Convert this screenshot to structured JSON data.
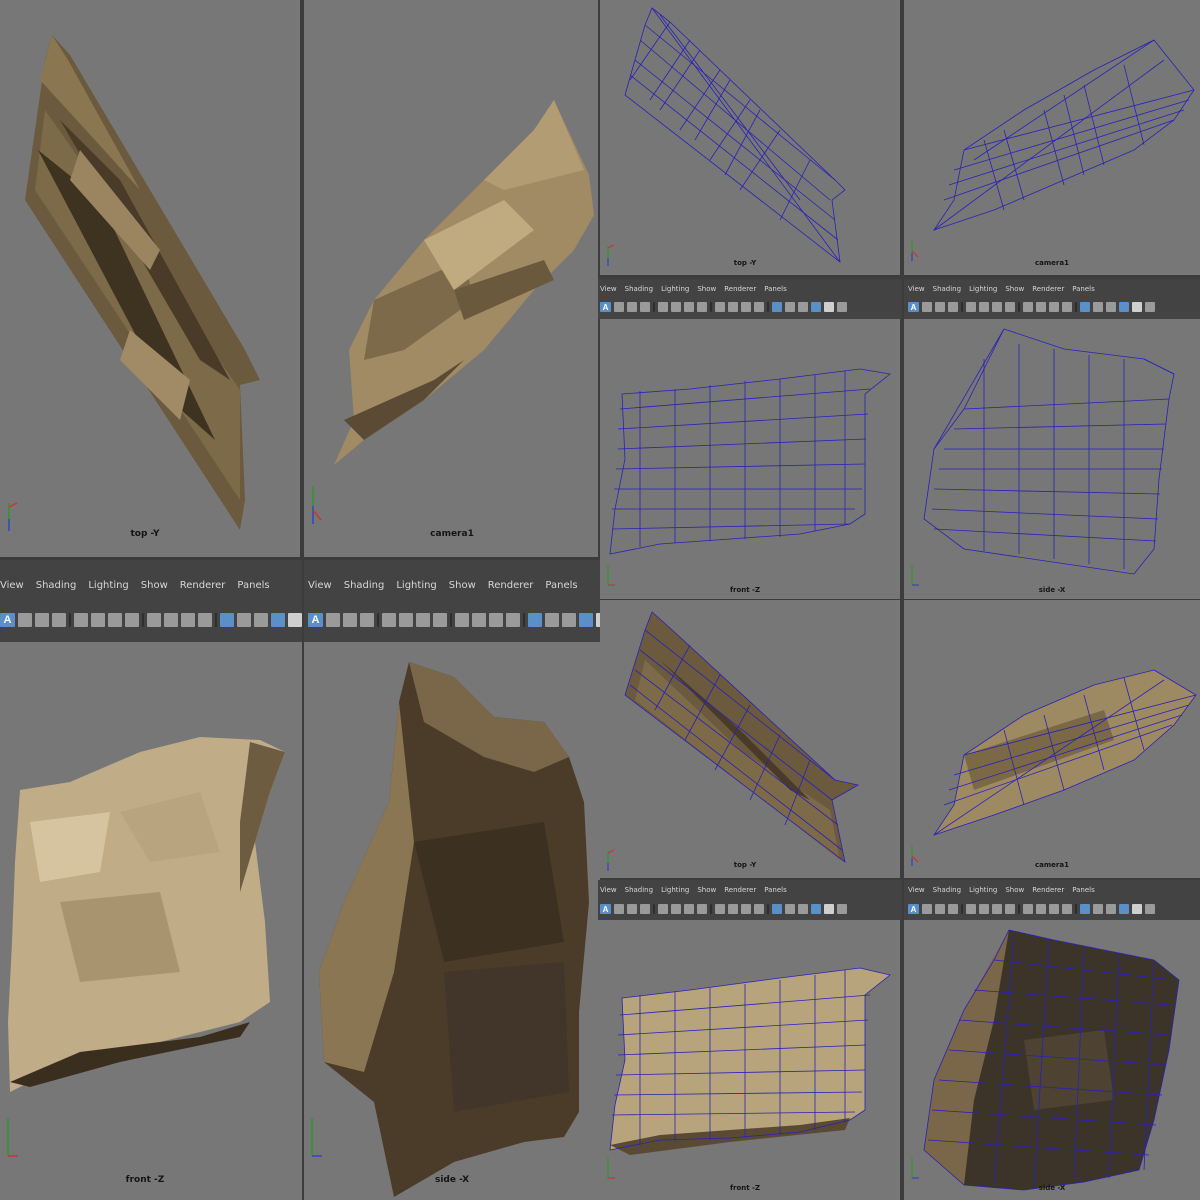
{
  "viewports": {
    "v1": {
      "camera": "top -Y"
    },
    "v2": {
      "camera": "camera1"
    },
    "v3": {
      "camera": "top -Y"
    },
    "v4": {
      "camera": "camera1"
    },
    "v5": {
      "camera": "front -Z"
    },
    "v6": {
      "camera": "side -X"
    },
    "v7": {
      "camera": "front -Z"
    },
    "v8": {
      "camera": "side -X"
    },
    "v9": {
      "camera": "top -Y"
    },
    "v10": {
      "camera": "camera1"
    },
    "v11": {
      "camera": "front -Z"
    },
    "v12": {
      "camera": "side -X"
    }
  },
  "panel_menu": {
    "wide": [
      "View",
      "Shading",
      "Lighting",
      "Show",
      "Renderer",
      "Panels"
    ]
  },
  "axis_labels": {
    "x": "x",
    "y": "y",
    "z": "z"
  },
  "toolbar_icons": [
    "select-all-icon",
    "grid-icon",
    "camera-icon",
    "bookmark-icon",
    "film-gate-icon",
    "resolution-gate-icon",
    "safe-title-icon",
    "field-chart-icon",
    "wireframe-icon",
    "smooth-shade-icon",
    "textured-icon",
    "lights-icon",
    "shadows-icon",
    "ambient-occlusion-icon",
    "isolate-icon",
    "xray-icon"
  ],
  "colors": {
    "viewport_bg": "#777777",
    "panel_bg": "#434343",
    "selected_blue": "#5a8fc8",
    "wire_blue": "#2a22b4",
    "mesh_tan": "#a08a62",
    "mesh_dark": "#5a4a34"
  }
}
